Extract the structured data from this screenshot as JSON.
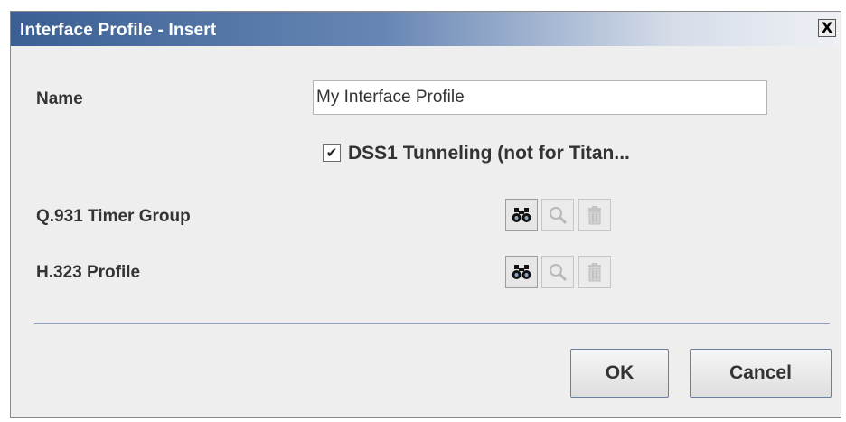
{
  "window": {
    "title": "Interface Profile - Insert",
    "close_glyph": "X"
  },
  "form": {
    "name_label": "Name",
    "name_value": "My Interface Profile",
    "tunneling_label": "DSS1 Tunneling (not for Titan...",
    "tunneling_checked": true,
    "tunneling_check_glyph": "✔",
    "q931_label": "Q.931 Timer Group",
    "h323_label": "H.323 Profile"
  },
  "icons": {
    "search": "binoculars-icon",
    "view": "magnifier-icon",
    "delete": "trash-icon"
  },
  "colors": {
    "titlebar_start": "#3b5f93",
    "dialog_bg": "#eeeeee",
    "separator": "#8c9fc4"
  },
  "buttons": {
    "ok": "OK",
    "cancel": "Cancel"
  }
}
